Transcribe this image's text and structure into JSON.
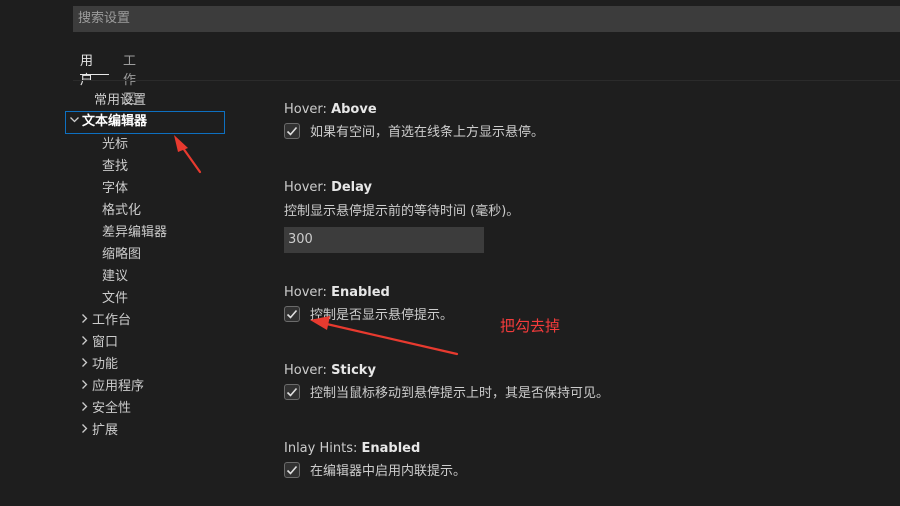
{
  "search": {
    "placeholder": "搜索设置"
  },
  "tabs": [
    {
      "label": "用户",
      "active": true
    },
    {
      "label": "工作区",
      "active": false
    }
  ],
  "tree": {
    "common": "常用设置",
    "text_editor": "文本编辑器",
    "children": [
      "光标",
      "查找",
      "字体",
      "格式化",
      "差异编辑器",
      "缩略图",
      "建议",
      "文件"
    ],
    "collapsed": [
      "工作台",
      "窗口",
      "功能",
      "应用程序",
      "安全性",
      "扩展"
    ]
  },
  "settings": {
    "above": {
      "prefix": "Hover: ",
      "name": "Above",
      "description": "如果有空间，首选在线条上方显示悬停。",
      "checked": true
    },
    "delay": {
      "prefix": "Hover: ",
      "name": "Delay",
      "description": "控制显示悬停提示前的等待时间 (毫秒)。",
      "value": "300"
    },
    "enabled": {
      "prefix": "Hover: ",
      "name": "Enabled",
      "description": "控制是否显示悬停提示。",
      "checked": true
    },
    "sticky": {
      "prefix": "Hover: ",
      "name": "Sticky",
      "description": "控制当鼠标移动到悬停提示上时，其是否保持可见。",
      "checked": true
    },
    "inlay": {
      "prefix": "Inlay Hints: ",
      "name": "Enabled",
      "description": "在编辑器中启用内联提示。",
      "checked": true
    }
  },
  "annotation": {
    "text": "把勾去掉",
    "color": "#f23b3b"
  },
  "colors": {
    "background": "#1e1e1e",
    "selection_border": "#0e70c0",
    "input_bg": "#3c3c3c"
  },
  "icons": {
    "check": "checkmark-icon",
    "expanded": "chevron-down-icon",
    "collapsed": "chevron-right-icon"
  }
}
